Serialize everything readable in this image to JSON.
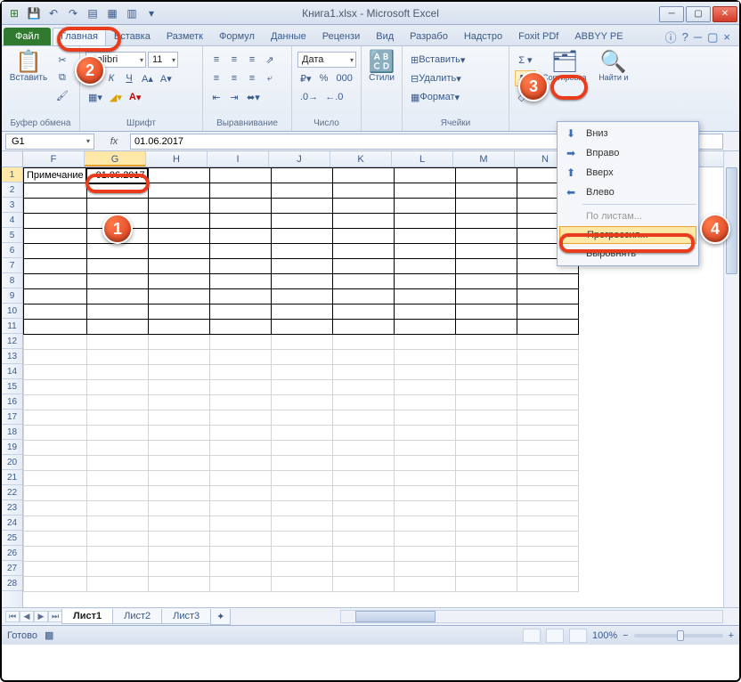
{
  "title": "Книга1.xlsx - Microsoft Excel",
  "tabs": {
    "file": "Файл",
    "list": [
      "Главная",
      "Вставка",
      "Разметк",
      "Формул",
      "Данные",
      "Рецензи",
      "Вид",
      "Разрабо",
      "Надстро",
      "Foxit PDf",
      "ABBYY PE"
    ]
  },
  "ribbon": {
    "clipboard": {
      "paste": "Вставить",
      "title": "Буфер обмена"
    },
    "font": {
      "name": "Calibri",
      "size": "11",
      "title": "Шрифт"
    },
    "alignment": {
      "title": "Выравнивание"
    },
    "number": {
      "format": "Дата",
      "title": "Число"
    },
    "styles": {
      "label": "Стили"
    },
    "cells": {
      "insert": "Вставить",
      "delete": "Удалить",
      "format": "Формат",
      "title": "Ячейки"
    },
    "editing": {
      "sort": "Сортировка",
      "find": "Найти и"
    }
  },
  "namebox": "G1",
  "formula": "01.06.2017",
  "columns": [
    "F",
    "G",
    "H",
    "I",
    "J",
    "K",
    "L",
    "M",
    "N"
  ],
  "rows_bordered": 11,
  "rows_unbord": 17,
  "cell_f1": "Примечание",
  "cell_g1": "01.06.2017",
  "fill_menu": {
    "down": "Вниз",
    "right": "Вправо",
    "up": "Вверх",
    "left": "Влево",
    "sheets": "По листам...",
    "progression": "Прогрессия...",
    "justify": "Выровнять"
  },
  "sheets": [
    "Лист1",
    "Лист2",
    "Лист3"
  ],
  "status": {
    "ready": "Готово",
    "zoom": "100%"
  },
  "callouts": {
    "c1": "1",
    "c2": "2",
    "c3": "3",
    "c4": "4"
  }
}
